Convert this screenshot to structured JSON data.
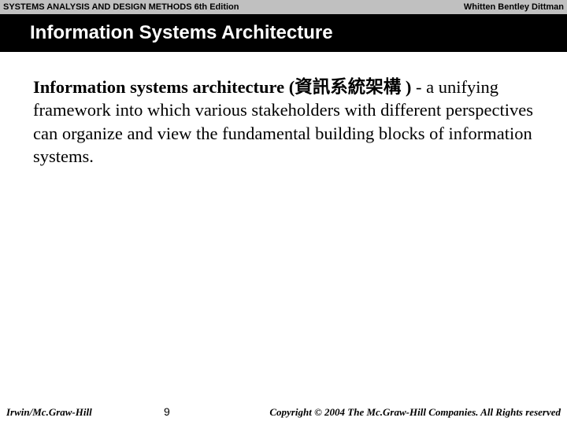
{
  "header": {
    "left": "SYSTEMS ANALYSIS AND DESIGN METHODS  6th Edition",
    "right": "Whitten  Bentley   Dittman"
  },
  "title": "Information Systems Architecture",
  "body": {
    "term": "Information systems architecture (資訊系統架構   ) ",
    "definition": "- a unifying framework into which various stakeholders with different perspectives can organize and view the fundamental building blocks of information systems."
  },
  "footer": {
    "left": "Irwin/Mc.Graw-Hill",
    "page": "9",
    "right": "Copyright © 2004 The Mc.Graw-Hill Companies. All Rights reserved"
  }
}
